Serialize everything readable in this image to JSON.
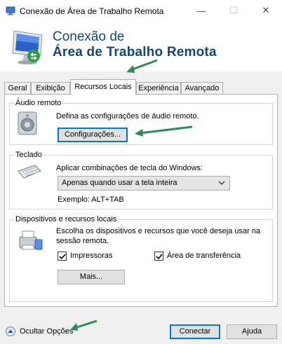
{
  "window": {
    "title": "Conexão de Área de Trabalho Remota",
    "minimize": "—",
    "maximize": "☐",
    "close": "✕"
  },
  "banner": {
    "line1": "Conexão de",
    "line2": "Área de Trabalho Remota"
  },
  "tabs": [
    {
      "label": "Geral"
    },
    {
      "label": "Exibição"
    },
    {
      "label": "Recursos Locais"
    },
    {
      "label": "Experiência"
    },
    {
      "label": "Avançado"
    }
  ],
  "audio": {
    "group_label": "Áudio remoto",
    "description": "Defina as configurações de áudio remoto.",
    "button": "Configurações..."
  },
  "keyboard": {
    "group_label": "Teclado",
    "description": "Aplicar combinações de tecla do Windows:",
    "select_value": "Apenas quando usar a tela inteira",
    "example": "Exemplo: ALT+TAB"
  },
  "devices": {
    "group_label": "Dispositivos e recursos locais",
    "description_line1": "Escolha os dispositivos e recursos que você deseja usar na",
    "description_line2": "sessão remota.",
    "printers_label": "Impressoras",
    "printers_checked": true,
    "clipboard_label": "Área de transferência",
    "clipboard_checked": true,
    "more_button": "Mais..."
  },
  "footer": {
    "hide_options": "Ocultar Opções",
    "connect": "Conectar",
    "help": "Ajuda"
  },
  "colors": {
    "annotation_arrow": "#2e8b57",
    "banner_text": "#14467a",
    "focus": "#0078d7"
  }
}
